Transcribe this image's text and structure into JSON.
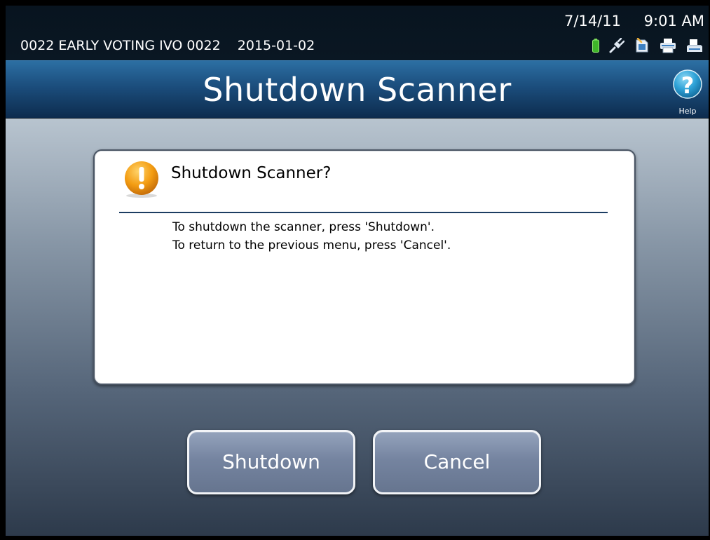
{
  "status_bar": {
    "precinct": "0022 EARLY VOTING IVO 0022",
    "election_date": "2015-01-02",
    "date": "7/14/11",
    "time": "9:01 AM",
    "icons": [
      "battery-icon",
      "power-plug-icon",
      "memory-card-icon",
      "printer-icon",
      "scanner-icon"
    ]
  },
  "title_bar": {
    "title": "Shutdown Scanner",
    "help_label": "Help"
  },
  "dialog": {
    "icon": "warning-icon",
    "title": "Shutdown Scanner?",
    "lines": [
      "To shutdown the scanner, press 'Shutdown'.",
      "To return to the previous menu, press 'Cancel'."
    ]
  },
  "buttons": {
    "shutdown_label": "Shutdown",
    "cancel_label": "Cancel"
  },
  "colors": {
    "title_bar": "#1b4d7c",
    "button": "#7584a0",
    "warning": "#f39c12",
    "help": "#2fa3d8"
  }
}
